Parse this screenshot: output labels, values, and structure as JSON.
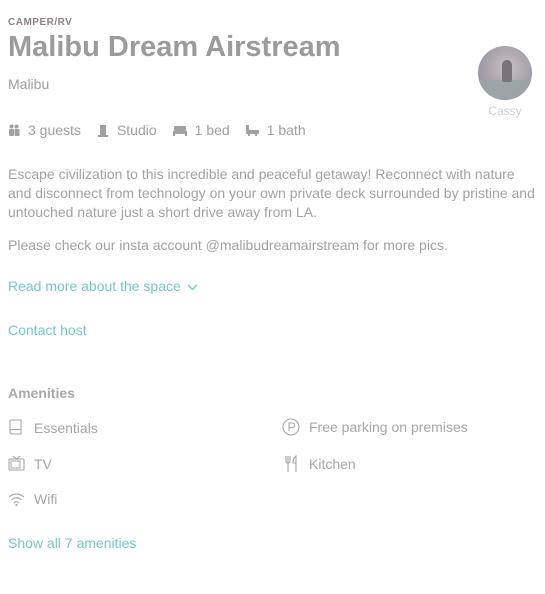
{
  "listing": {
    "type": "CAMPER/RV",
    "title": "Malibu Dream Airstream",
    "location": "Malibu"
  },
  "host": {
    "name": "Cassy",
    "avatar_icon": "host-photo"
  },
  "facts": [
    {
      "icon": "guests-icon",
      "label": "3 guests"
    },
    {
      "icon": "door-icon",
      "label": "Studio"
    },
    {
      "icon": "bed-icon",
      "label": "1 bed"
    },
    {
      "icon": "bath-icon",
      "label": "1 bath"
    }
  ],
  "description": [
    "Escape civilization to this incredible and peaceful getaway! Reconnect with nature and disconnect from technology on your own private deck surrounded by pristine and untouched nature just a short drive away from LA.",
    "Please check our insta account @malibudreamairstream for more pics."
  ],
  "links": {
    "read_more": "Read more about the space",
    "contact_host": "Contact host",
    "show_amenities": "Show all 7 amenities"
  },
  "amenities": {
    "heading": "Amenities",
    "items": [
      {
        "icon": "essentials-icon",
        "label": "Essentials"
      },
      {
        "icon": "parking-icon",
        "label": "Free parking on premises"
      },
      {
        "icon": "tv-icon",
        "label": "TV"
      },
      {
        "icon": "kitchen-icon",
        "label": "Kitchen"
      },
      {
        "icon": "wifi-icon",
        "label": "Wifi"
      }
    ]
  },
  "colors": {
    "accent": "#74c7c7",
    "text": "#a2a2a2",
    "type_label": "#8c7f88"
  }
}
